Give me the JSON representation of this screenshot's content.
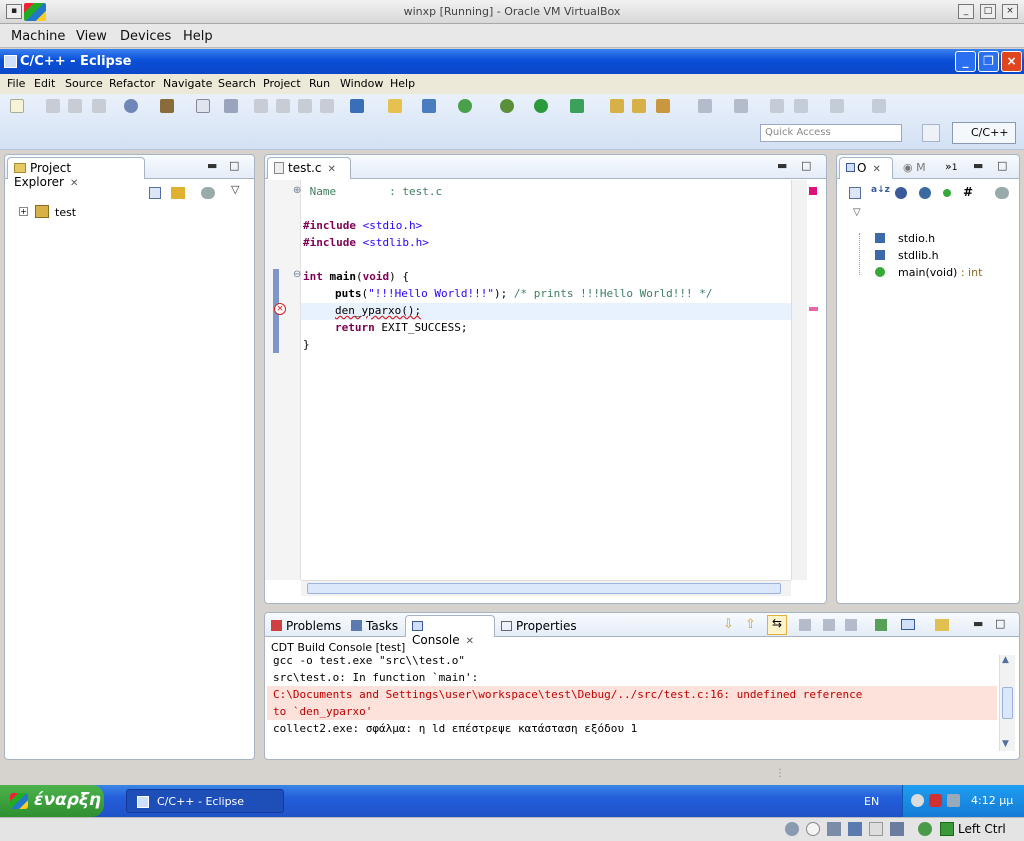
{
  "vbox": {
    "title": "winxp [Running] - Oracle VM VirtualBox",
    "menu": [
      "Machine",
      "View",
      "Devices",
      "Help"
    ],
    "status_host_key": "Left Ctrl"
  },
  "eclipse": {
    "window_title": "C/C++ - Eclipse",
    "menu": [
      "File",
      "Edit",
      "Source",
      "Refactor",
      "Navigate",
      "Search",
      "Project",
      "Run",
      "Window",
      "Help"
    ],
    "quick_access_placeholder": "Quick Access",
    "perspective": "C/C++"
  },
  "project_explorer": {
    "tab": "Project Explorer",
    "tree": [
      {
        "label": "test",
        "icon": "c-project-icon"
      }
    ]
  },
  "editor": {
    "tab": "test.c",
    "lines": {
      "header_comment": " Name        : test.c",
      "include1_kw": "#include",
      "include1_file": "<stdio.h>",
      "include2_kw": "#include",
      "include2_file": "<stdlib.h>",
      "main_type": "int",
      "main_name": "main",
      "main_args_kw": "void",
      "puts_fn": "puts",
      "puts_str": "\"!!!Hello World!!!\"",
      "puts_cmt": "/* prints !!!Hello World!!! */",
      "err_call": "den_yparxo();",
      "return_kw": "return",
      "return_val": "EXIT_SUCCESS;",
      "close_brace": "}"
    }
  },
  "outline": {
    "tab_outline": "O",
    "tab_make": "M",
    "tab_more": "1",
    "items": [
      {
        "label": "stdio.h",
        "type": "include"
      },
      {
        "label": "stdlib.h",
        "type": "include"
      },
      {
        "label": "main(void)",
        "suffix": " : int",
        "type": "function"
      }
    ]
  },
  "console": {
    "tabs": [
      "Problems",
      "Tasks",
      "Console",
      "Properties"
    ],
    "active_tab": "Console",
    "header": "CDT Build Console [test]",
    "lines": [
      {
        "text": "gcc -o test.exe \"src\\\\test.o\"",
        "type": "normal"
      },
      {
        "text": "src\\test.o: In function `main':",
        "type": "normal"
      },
      {
        "text": "C:\\Documents and Settings\\user\\workspace\\test\\Debug/../src/test.c:16: undefined reference",
        "type": "error"
      },
      {
        "text": "to `den_yparxo'",
        "type": "error"
      },
      {
        "text": "collect2.exe: σφάλμα: η ld επέστρεψε κατάσταση εξόδου 1",
        "type": "normal"
      }
    ]
  },
  "taskbar": {
    "start_label": "έναρξη",
    "task_label": "C/C++ - Eclipse",
    "lang": "EN",
    "clock": "4:12 μμ"
  },
  "colors": {
    "xp_blue": "#0a4fd8",
    "start_green": "#2e8f2e",
    "error_bg": "#fde2dc",
    "keyword": "#7f0055",
    "string": "#2a00ff"
  }
}
